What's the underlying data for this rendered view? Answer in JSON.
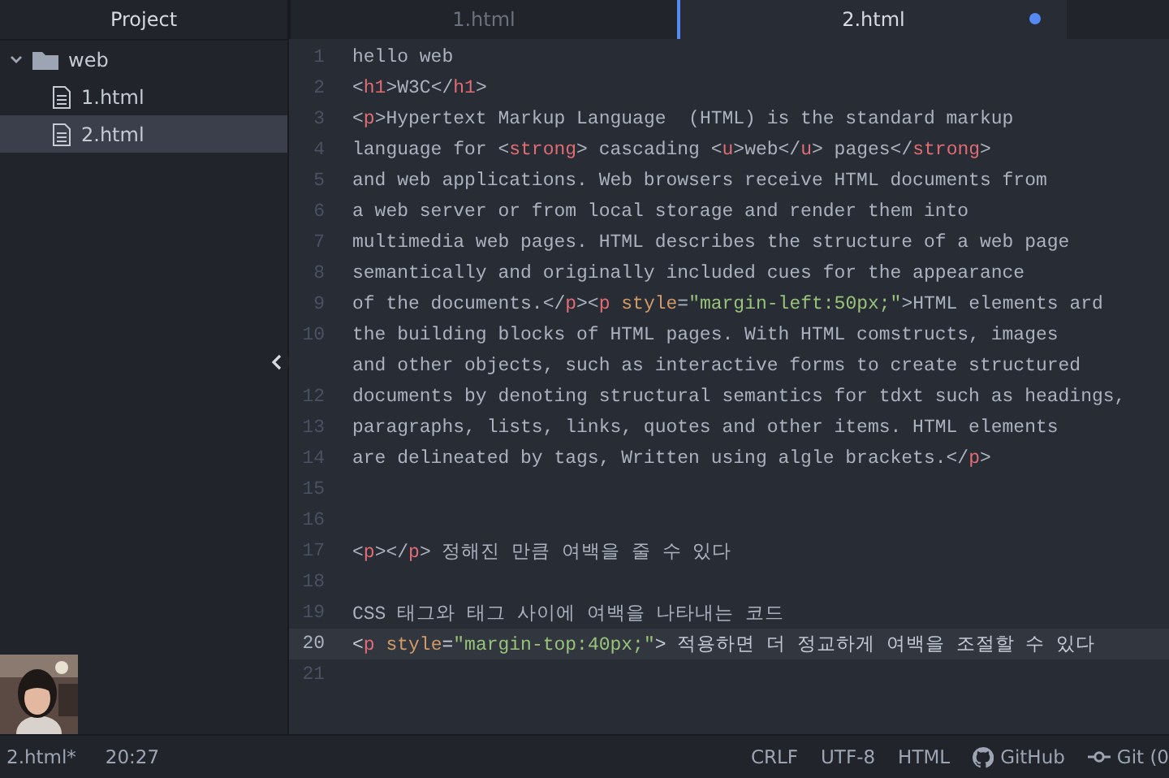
{
  "sidebar": {
    "title": "Project",
    "tree": [
      {
        "label": "web",
        "kind": "folder",
        "expanded": true,
        "selected": false,
        "children": [
          {
            "label": "1.html",
            "kind": "file",
            "selected": false
          },
          {
            "label": "2.html",
            "kind": "file",
            "selected": true
          }
        ]
      }
    ]
  },
  "tabs": [
    {
      "label": "1.html",
      "selected": false,
      "modified": false
    },
    {
      "label": "2.html",
      "selected": true,
      "modified": true
    }
  ],
  "editor": {
    "lines": [
      {
        "number": "1",
        "current": false,
        "segments": [
          {
            "kind": "text",
            "text": "hello web"
          }
        ]
      },
      {
        "number": "2",
        "current": false,
        "segments": [
          {
            "kind": "text",
            "text": "<"
          },
          {
            "kind": "tag",
            "text": "h1"
          },
          {
            "kind": "text",
            "text": ">W3C</"
          },
          {
            "kind": "tag",
            "text": "h1"
          },
          {
            "kind": "text",
            "text": ">"
          }
        ]
      },
      {
        "number": "3",
        "current": false,
        "segments": [
          {
            "kind": "text",
            "text": "<"
          },
          {
            "kind": "tag",
            "text": "p"
          },
          {
            "kind": "text",
            "text": ">Hypertext Markup Language  (HTML) is the standard markup"
          }
        ]
      },
      {
        "number": "4",
        "current": false,
        "segments": [
          {
            "kind": "text",
            "text": "language for <"
          },
          {
            "kind": "tag",
            "text": "strong"
          },
          {
            "kind": "text",
            "text": "> cascading <"
          },
          {
            "kind": "tag",
            "text": "u"
          },
          {
            "kind": "text",
            "text": ">web</"
          },
          {
            "kind": "tag",
            "text": "u"
          },
          {
            "kind": "text",
            "text": "> pages</"
          },
          {
            "kind": "tag",
            "text": "strong"
          },
          {
            "kind": "text",
            "text": ">"
          }
        ]
      },
      {
        "number": "5",
        "current": false,
        "segments": [
          {
            "kind": "text",
            "text": "and web applications. Web browsers receive HTML documents from"
          }
        ]
      },
      {
        "number": "6",
        "current": false,
        "segments": [
          {
            "kind": "text",
            "text": "a web server or from local storage and render them into"
          }
        ]
      },
      {
        "number": "7",
        "current": false,
        "segments": [
          {
            "kind": "text",
            "text": "multimedia web pages. HTML describes the structure of a web page"
          }
        ]
      },
      {
        "number": "8",
        "current": false,
        "segments": [
          {
            "kind": "text",
            "text": "semantically and originally included cues for the appearance"
          }
        ]
      },
      {
        "number": "9",
        "current": false,
        "segments": [
          {
            "kind": "text",
            "text": "of the documents.</"
          },
          {
            "kind": "tag",
            "text": "p"
          },
          {
            "kind": "text",
            "text": "><"
          },
          {
            "kind": "tag",
            "text": "p"
          },
          {
            "kind": "attr",
            "text": " style"
          },
          {
            "kind": "text",
            "text": "="
          },
          {
            "kind": "string",
            "text": "\"margin-left:50px;\""
          },
          {
            "kind": "text",
            "text": ">HTML elements ard"
          }
        ]
      },
      {
        "number": "10",
        "current": false,
        "segments": [
          {
            "kind": "text",
            "text": "the building blocks of HTML pages. With HTML comstructs, images"
          }
        ]
      },
      {
        "current": false,
        "segments": [
          {
            "kind": "text",
            "text": "and other objects, such as interactive forms to create structured"
          }
        ]
      },
      {
        "number": "12",
        "current": false,
        "segments": [
          {
            "kind": "text",
            "text": "documents by denoting structural semantics for tdxt such as headings,"
          }
        ]
      },
      {
        "number": "13",
        "current": false,
        "segments": [
          {
            "kind": "text",
            "text": "paragraphs, lists, links, quotes and other items. HTML elements"
          }
        ]
      },
      {
        "number": "14",
        "current": false,
        "segments": [
          {
            "kind": "text",
            "text": "are delineated by tags, Written using algle brackets.</"
          },
          {
            "kind": "tag",
            "text": "p"
          },
          {
            "kind": "text",
            "text": ">"
          }
        ]
      },
      {
        "number": "15",
        "current": false
      },
      {
        "number": "16",
        "current": false
      },
      {
        "number": "17",
        "current": false,
        "segments": [
          {
            "kind": "text",
            "text": "<"
          },
          {
            "kind": "tag",
            "text": "p"
          },
          {
            "kind": "text",
            "text": "></"
          },
          {
            "kind": "tag",
            "text": "p"
          },
          {
            "kind": "text",
            "text": "> 정해진 만큼 여백을 줄 수 있다"
          }
        ]
      },
      {
        "number": "18",
        "current": false
      },
      {
        "number": "19",
        "current": false,
        "segments": [
          {
            "kind": "text",
            "text": "CSS 태그와 태그 사이에 여백을 나타내는 코드"
          }
        ]
      },
      {
        "number": "20",
        "current": true,
        "segments": [
          {
            "kind": "text",
            "text": "<"
          },
          {
            "kind": "tag",
            "text": "p"
          },
          {
            "kind": "attr",
            "text": " style"
          },
          {
            "kind": "text",
            "text": "="
          },
          {
            "kind": "string",
            "text": "\"margin-top:40px;\""
          },
          {
            "kind": "text",
            "text": "> 적용하면 더 정교하게 여백을 조절할 수 있다"
          }
        ]
      },
      {
        "number": "21",
        "current": false
      }
    ]
  },
  "status_bar": {
    "file": "2.html*",
    "cursor": "20:27",
    "items": [
      {
        "label": "CRLF",
        "kind": "plain"
      },
      {
        "label": "UTF-8",
        "kind": "plain"
      },
      {
        "label": "HTML",
        "kind": "plain"
      },
      {
        "label": "GitHub",
        "kind": "github"
      },
      {
        "label": "Git (0",
        "kind": "git"
      }
    ]
  }
}
